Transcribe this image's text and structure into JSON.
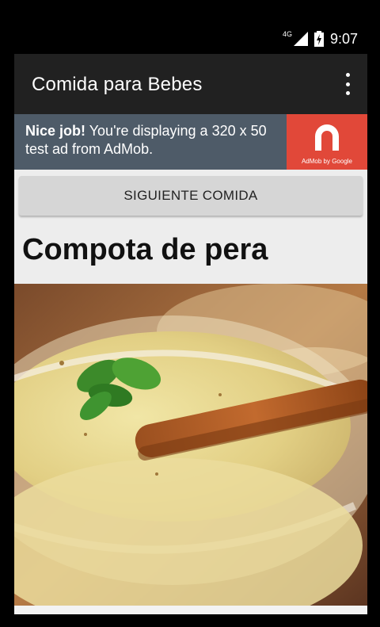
{
  "status_bar": {
    "network_type": "4G",
    "time": "9:07",
    "icons": [
      "signal-icon",
      "battery-icon"
    ]
  },
  "app_bar": {
    "title": "Comida para Bebes",
    "menu_icon": "overflow-menu-icon"
  },
  "ad": {
    "bold_text": "Nice job!",
    "text": " You're displaying a 320 x 50 test ad from AdMob.",
    "logo_caption": "AdMob by Google",
    "brand_color": "#e14839",
    "background_color": "#4e5b68"
  },
  "actions": {
    "next_label": "SIGUIENTE COMIDA"
  },
  "recipe": {
    "title": "Compota de pera",
    "image": "pear-compote-photo"
  }
}
